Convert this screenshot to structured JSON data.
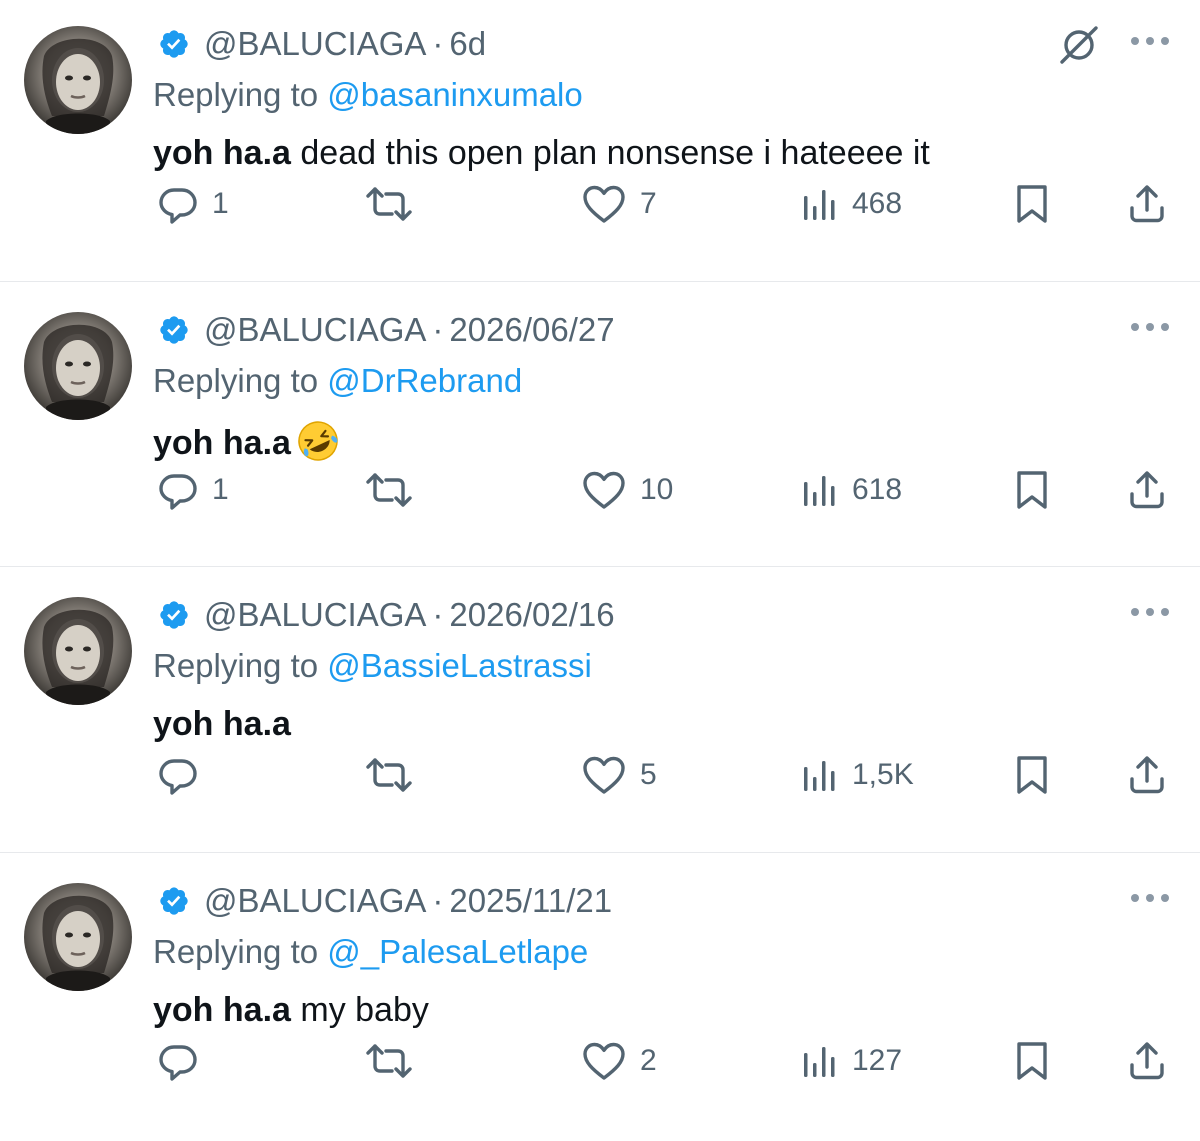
{
  "colors": {
    "accent": "#1d9bf0",
    "muted": "#536471",
    "text": "#0f1419",
    "divider": "#e7e9ec"
  },
  "icons": {
    "verified": "verified-badge-icon",
    "hide": "circle-slash-icon",
    "more": "more-dots-icon",
    "reply": "comment-bubble-icon",
    "retweet": "retweet-icon",
    "like": "heart-icon",
    "views": "bar-chart-icon",
    "bookmark": "bookmark-icon",
    "share": "share-upload-icon"
  },
  "tweets": [
    {
      "handle": "@BALUCIAGA",
      "separator": "·",
      "time": "6d",
      "replying_prefix": "Replying to ",
      "replying_to": "@basaninxumalo",
      "bold_text": "yoh ha.a",
      "rest_text": " dead this open plan nonsense i hateeee it",
      "emoji": "",
      "replies": "1",
      "retweets": "",
      "likes": "7",
      "views": "468"
    },
    {
      "handle": "@BALUCIAGA",
      "separator": "·",
      "time": "2026/06/27",
      "replying_prefix": "Replying to ",
      "replying_to": "@DrRebrand",
      "bold_text": "yoh ha.a",
      "rest_text": "",
      "emoji": "rolling-on-floor-laughing",
      "replies": "1",
      "retweets": "",
      "likes": "10",
      "views": "618"
    },
    {
      "handle": "@BALUCIAGA",
      "separator": "·",
      "time": "2026/02/16",
      "replying_prefix": "Replying to ",
      "replying_to": "@BassieLastrassi",
      "bold_text": "yoh ha.a",
      "rest_text": "",
      "emoji": "",
      "replies": "",
      "retweets": "",
      "likes": "5",
      "views": "1,5K"
    },
    {
      "handle": "@BALUCIAGA",
      "separator": "·",
      "time": "2025/11/21",
      "replying_prefix": "Replying to ",
      "replying_to": "@_PalesaLetlape",
      "bold_text": "yoh ha.a",
      "rest_text": " my baby",
      "emoji": "",
      "replies": "",
      "retweets": "",
      "likes": "2",
      "views": "127"
    }
  ]
}
